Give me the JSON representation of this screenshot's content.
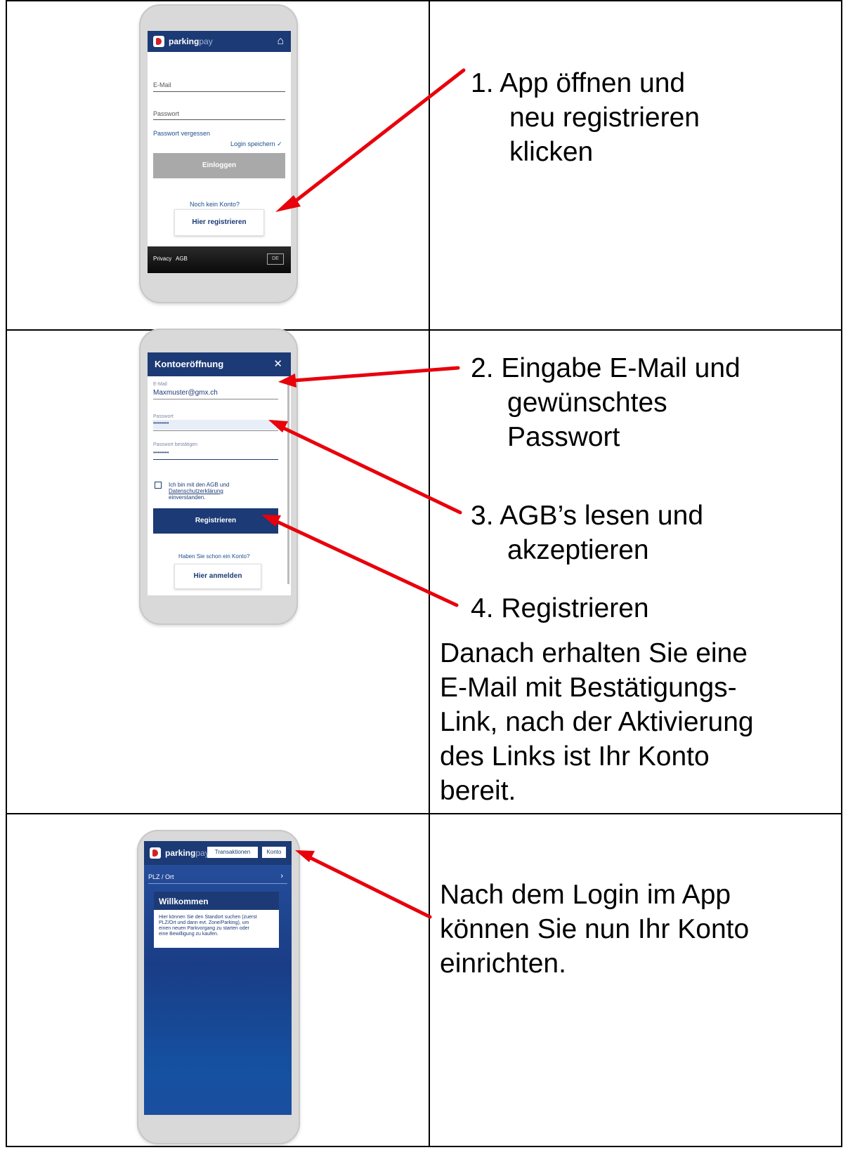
{
  "phone1": {
    "brand_main": "parking",
    "brand_suffix": "pay",
    "email_label": "E-Mail",
    "password_label": "Passwort",
    "forgot_link": "Passwort vergessen",
    "save_login": "Login speichern",
    "login_button": "Einloggen",
    "no_account": "Noch kein Konto?",
    "register_button": "Hier registrieren",
    "footer_privacy": "Privacy",
    "footer_agb": "AGB",
    "footer_lang": "DE"
  },
  "phone2": {
    "title": "Kontoeröffnung",
    "email_label": "E-Mail",
    "email_value": "Maxmuster@gmx.ch",
    "password_label": "Passwort",
    "password_value": "••••••••",
    "confirm_label": "Passwort bestätigen",
    "confirm_value": "••••••••",
    "agree_line1": "Ich bin mit den AGB und",
    "agree_line2": "Datenschutzerklärung",
    "agree_line3": "einverstanden.",
    "register_button": "Registrieren",
    "have_account": "Haben Sie schon ein Konto?",
    "login_button": "Hier anmelden"
  },
  "phone3": {
    "brand_main": "parking",
    "brand_suffix": "pay",
    "tab_transactions": "Transaktionen",
    "tab_account": "Konto",
    "search_label": "PLZ / Ort",
    "welcome_title": "Willkommen",
    "welcome_line1": "Hier können Sie den Standort suchen (zuerst",
    "welcome_line2": "PLZ/Ort und dann evt. Zone/Parking), um",
    "welcome_line3": "einen neuen Parkvorgang zu starten oder",
    "welcome_line4": "eine Bewilligung zu kaufen."
  },
  "steps": {
    "s1_line1": "1.  App öffnen und",
    "s1_line2": "neu registrieren",
    "s1_line3": "klicken",
    "s2_line1": "2. Eingabe E-Mail und",
    "s2_line2": "gewünschtes",
    "s2_line3": "Passwort",
    "s3_line1": "3. AGB’s lesen und",
    "s3_line2": "akzeptieren",
    "s4_line1": "4. Registrieren",
    "after_line1": "Danach erhalten Sie eine",
    "after_line2": "E-Mail mit Bestätigungs-",
    "after_line3": "Link, nach der Aktivierung",
    "after_line4": "des Links ist Ihr Konto",
    "after_line5": "bereit.",
    "final_line1": "Nach dem Login im App",
    "final_line2": "können Sie nun Ihr Konto",
    "final_line3": "einrichten."
  },
  "colors": {
    "navy": "#1c3a75",
    "arrow": "#e8000b"
  }
}
